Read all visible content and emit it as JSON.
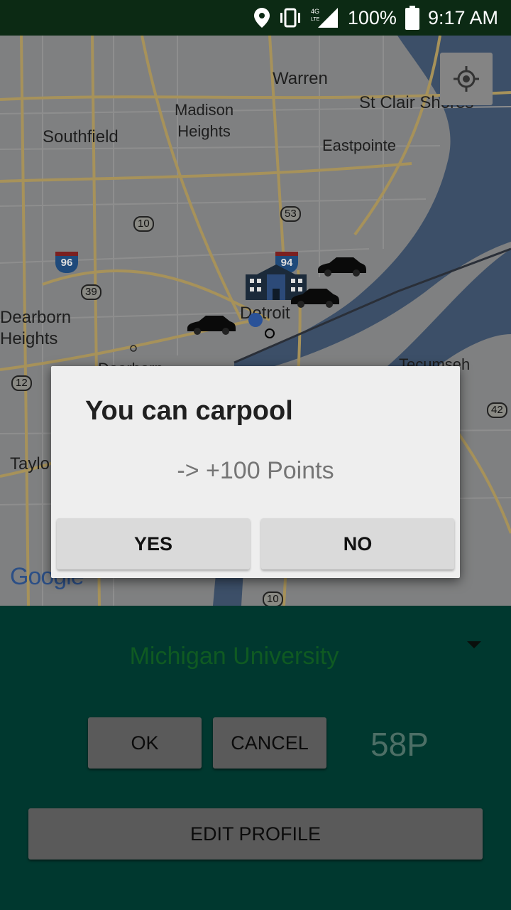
{
  "status_bar": {
    "network": "4G LTE",
    "battery": "100%",
    "time": "9:17 AM"
  },
  "map": {
    "labels": {
      "warren": "Warren",
      "st_clair_shores": "St Clair Shores",
      "madison_heights": "Madison\nHeights",
      "southfield": "Southfield",
      "eastpointe": "Eastpointe",
      "dearborn_heights": "Dearborn\nHeights",
      "detroit": "Detroit",
      "dearborn": "Dearborn",
      "taylor": "Taylo",
      "tecumseh": "Tecumseh"
    },
    "shields": {
      "r10": "10",
      "r53": "53",
      "r39": "39",
      "r12": "12",
      "r42": "42",
      "r10b": "10",
      "i96": "96",
      "i94": "94"
    },
    "attribution": "Google"
  },
  "dialog": {
    "title": "You can carpool",
    "message": "-> +100 Points",
    "yes_label": "YES",
    "no_label": "NO"
  },
  "panel": {
    "destination": "Michigan University",
    "ok_label": "OK",
    "cancel_label": "CANCEL",
    "points": "58P",
    "edit_profile_label": "EDIT PROFILE"
  }
}
